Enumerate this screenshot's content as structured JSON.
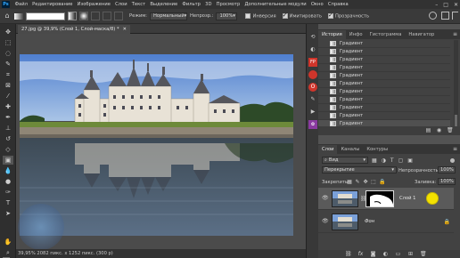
{
  "menu": {
    "logo": "Ps",
    "items": [
      "Файл",
      "Редактирование",
      "Изображение",
      "Слои",
      "Текст",
      "Выделение",
      "Фильтр",
      "3D",
      "Просмотр",
      "Дополнительные модули",
      "Окно",
      "Справка"
    ],
    "window_controls": [
      "–",
      "□",
      "✕"
    ]
  },
  "options": {
    "mode_label": "Режим:",
    "mode_value": "Нормальный",
    "opacity_label": "Непрозр.:",
    "opacity_value": "100%",
    "inverse_label": "Инверсия",
    "dither_label": "Имитировать",
    "transparency_label": "Прозрачность"
  },
  "document": {
    "tab_title": "27.jpg @ 39,9% (Слой 1, Слой-маска/8) *",
    "tab_close": "✕",
    "status": "39,95%  2082 пикс. x 1252 пикс. (300 р)"
  },
  "history_panel": {
    "tabs": [
      "История",
      "Инфо",
      "Гистограмма",
      "Навигатор"
    ],
    "active_tab": "История",
    "rows": [
      "Градиент",
      "Градиент",
      "Градиент",
      "Градиент",
      "Градиент",
      "Градиент",
      "Градиент",
      "Градиент",
      "Градиент",
      "Градиент",
      "Градиент"
    ],
    "menu_icon": "≡"
  },
  "layers_panel": {
    "tabs": [
      "Слои",
      "Каналы",
      "Контуры"
    ],
    "active_tab": "Слои",
    "filter_label": "Вид",
    "blend_mode": "Перекрытие",
    "opacity_label": "Непрозрачность:",
    "opacity_value": "100%",
    "lock_label": "Закрепить:",
    "fill_label": "Заливка:",
    "fill_value": "100%",
    "layers": [
      {
        "name": "Слой 1",
        "selected": true,
        "has_mask": true
      },
      {
        "name": "Фон",
        "selected": false,
        "has_mask": false
      }
    ]
  },
  "colors": {
    "accent": "#31a8ff",
    "cursor_highlight": "#f3e100",
    "foreground": "#ffffff",
    "background": "#000000"
  }
}
